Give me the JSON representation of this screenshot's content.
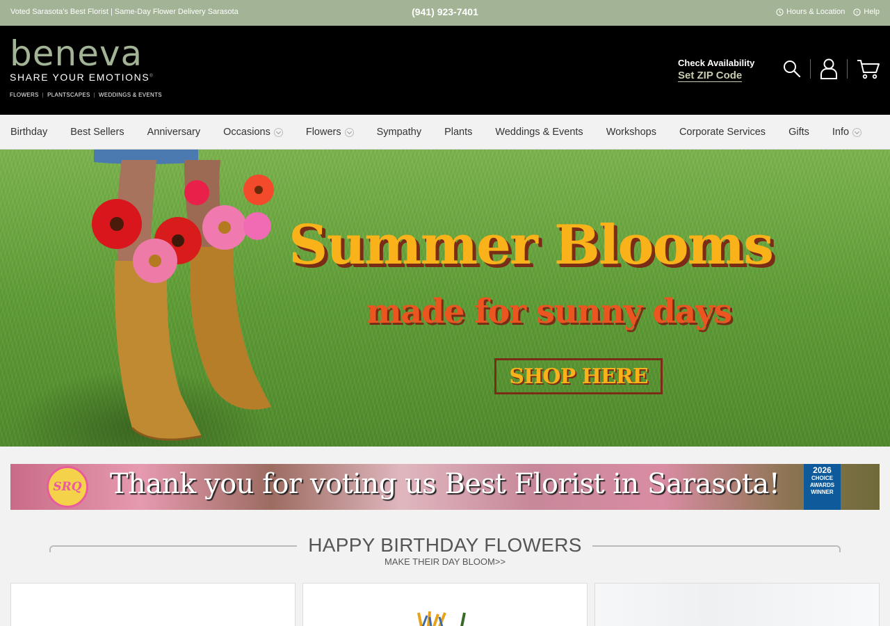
{
  "topbar": {
    "tagline": "Voted Sarasota's Best Florist | Same-Day Flower Delivery Sarasota",
    "phone": "(941) 923-7401",
    "hours_label": "Hours & Location",
    "help_label": "Help"
  },
  "header": {
    "logo_word": "beneva",
    "logo_tagline": "SHARE YOUR EMOTIONS",
    "logo_reg": "®",
    "logo_sub": [
      "FLOWERS",
      "PLANTSCAPES",
      "WEDDINGS & EVENTS"
    ],
    "logo_sep": "|",
    "availability_label": "Check Availability",
    "zip_label": "Set ZIP Code",
    "icons": [
      "search-icon",
      "account-icon",
      "cart-icon"
    ]
  },
  "nav": {
    "items": [
      {
        "label": "Birthday",
        "dropdown": false
      },
      {
        "label": "Best Sellers",
        "dropdown": false
      },
      {
        "label": "Anniversary",
        "dropdown": false
      },
      {
        "label": "Occasions",
        "dropdown": true
      },
      {
        "label": "Flowers",
        "dropdown": true
      },
      {
        "label": "Sympathy",
        "dropdown": false
      },
      {
        "label": "Plants",
        "dropdown": false
      },
      {
        "label": "Weddings & Events",
        "dropdown": false
      },
      {
        "label": "Workshops",
        "dropdown": false
      },
      {
        "label": "Corporate Services",
        "dropdown": false
      },
      {
        "label": "Gifts",
        "dropdown": false
      },
      {
        "label": "Info",
        "dropdown": true
      }
    ]
  },
  "hero": {
    "headline": "Summer Blooms",
    "subheadline": "made for sunny days",
    "cta": "SHOP HERE"
  },
  "vote_banner": {
    "text": "Thank you for voting us Best Florist in Sarasota!",
    "badge_left": "SRQ",
    "badge_right_year": "2026",
    "badge_right_lines": [
      "CHOICE",
      "AWARDS",
      "WINNER"
    ]
  },
  "section": {
    "title": "HAPPY BIRTHDAY FLOWERS",
    "subtitle": "MAKE THEIR DAY BLOOM>>"
  },
  "colors": {
    "topbar_bg": "#a3b396",
    "header_bg": "#000000",
    "brand_sage": "#a3b396",
    "hero_yellow": "#f9b21a",
    "hero_orange": "#ea5520",
    "hero_shadow": "#7a2c17"
  }
}
